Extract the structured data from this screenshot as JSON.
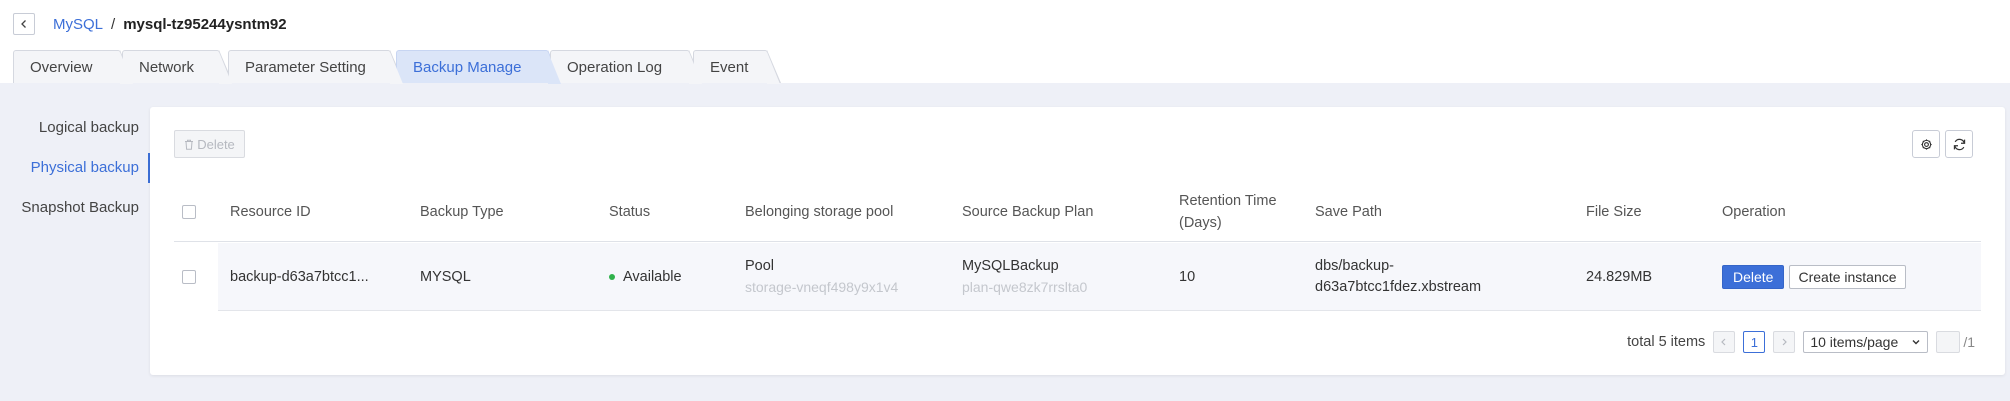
{
  "header": {
    "back_icon": "chevron-left-icon",
    "breadcrumb_root": "MySQL",
    "breadcrumb_sep": "/",
    "breadcrumb_current": "mysql-tz95244ysntm92"
  },
  "tabs": [
    {
      "label": "Overview",
      "active": false
    },
    {
      "label": "Network",
      "active": false
    },
    {
      "label": "Parameter Setting",
      "active": false
    },
    {
      "label": "Backup Manage",
      "active": true
    },
    {
      "label": "Operation Log",
      "active": false
    },
    {
      "label": "Event",
      "active": false
    }
  ],
  "side_nav": [
    {
      "label": "Logical backup",
      "active": false
    },
    {
      "label": "Physical backup",
      "active": true
    },
    {
      "label": "Snapshot Backup",
      "active": false
    }
  ],
  "toolbar": {
    "delete_label": "Delete",
    "delete_icon": "trash-icon",
    "settings_icon": "gear-icon",
    "refresh_icon": "refresh-icon"
  },
  "table": {
    "columns": [
      "Resource ID",
      "Backup Type",
      "Status",
      "Belonging storage pool",
      "Source Backup Plan",
      "Retention Time",
      "(Days)",
      "Save Path",
      "File Size",
      "Operation"
    ],
    "rows": [
      {
        "resource_id": "backup-d63a7btcc1...",
        "backup_type": "MYSQL",
        "status": "Available",
        "status_color": "#2fb14b",
        "pool_name": "Pool",
        "pool_id": "storage-vneqf498y9x1v4",
        "plan_name": "MySQLBackup",
        "plan_id": "plan-qwe8zk7rrslta0",
        "retention": "10",
        "save_path_1": "dbs/backup-",
        "save_path_2": "d63a7btcc1fdez.xbstream",
        "file_size": "24.829MB",
        "op_delete": "Delete",
        "op_create": "Create instance"
      }
    ]
  },
  "pagination": {
    "total_text": "total 5 items",
    "current_page": "1",
    "page_size": "10 items/page",
    "total_pages": "/1"
  },
  "colors": {
    "accent": "#3c6fd8",
    "background": "#eef0f7",
    "status_available": "#2fb14b"
  }
}
